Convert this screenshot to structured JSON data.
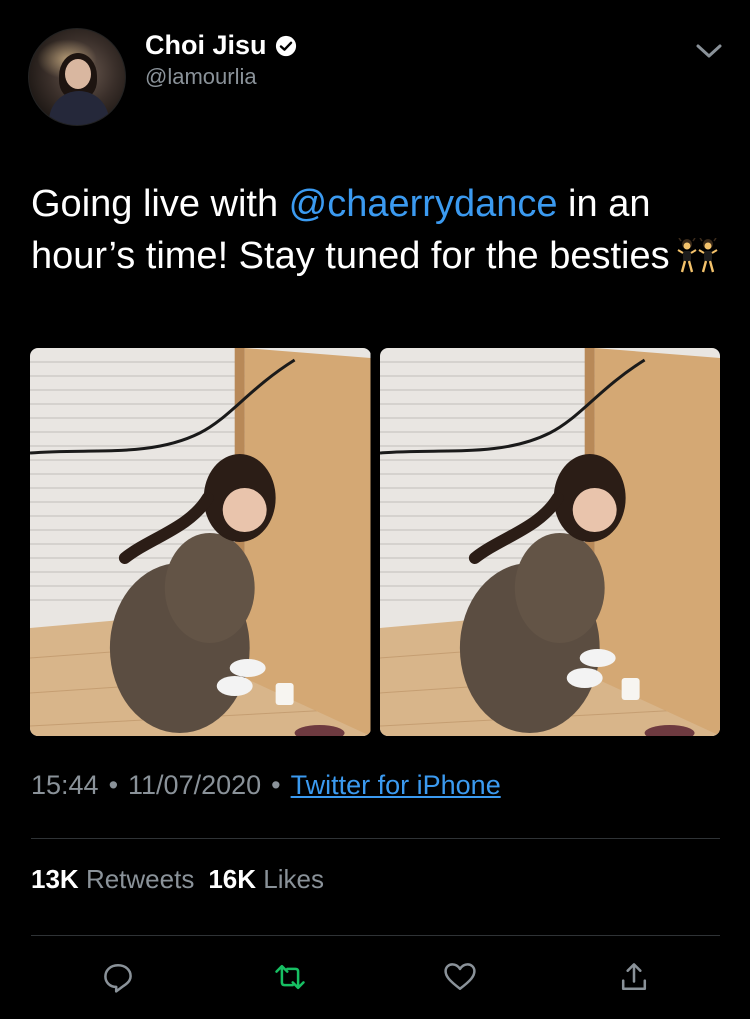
{
  "user": {
    "display_name": "Choi Jisu",
    "handle": "@lamourlia",
    "verified": true
  },
  "tweet": {
    "text_before": "Going live with ",
    "mention": "@chaerrydance",
    "text_after": " in an hour’s time! Stay tuned for the besties"
  },
  "meta": {
    "time": "15:44",
    "separator": "•",
    "date": "11/07/2020",
    "source": "Twitter for iPhone"
  },
  "stats": {
    "retweets_count": "13K",
    "retweets_label": "Retweets",
    "likes_count": "16K",
    "likes_label": "Likes"
  },
  "icons": {
    "reply": "reply-icon",
    "retweet": "retweet-icon",
    "like": "heart-icon",
    "share": "share-icon",
    "menu": "chevron-down-icon"
  },
  "colors": {
    "background": "#000000",
    "accent": "#3b9af0",
    "secondary_text": "#8a9299",
    "retweet": "#17bf63",
    "divider": "#2f3336"
  }
}
